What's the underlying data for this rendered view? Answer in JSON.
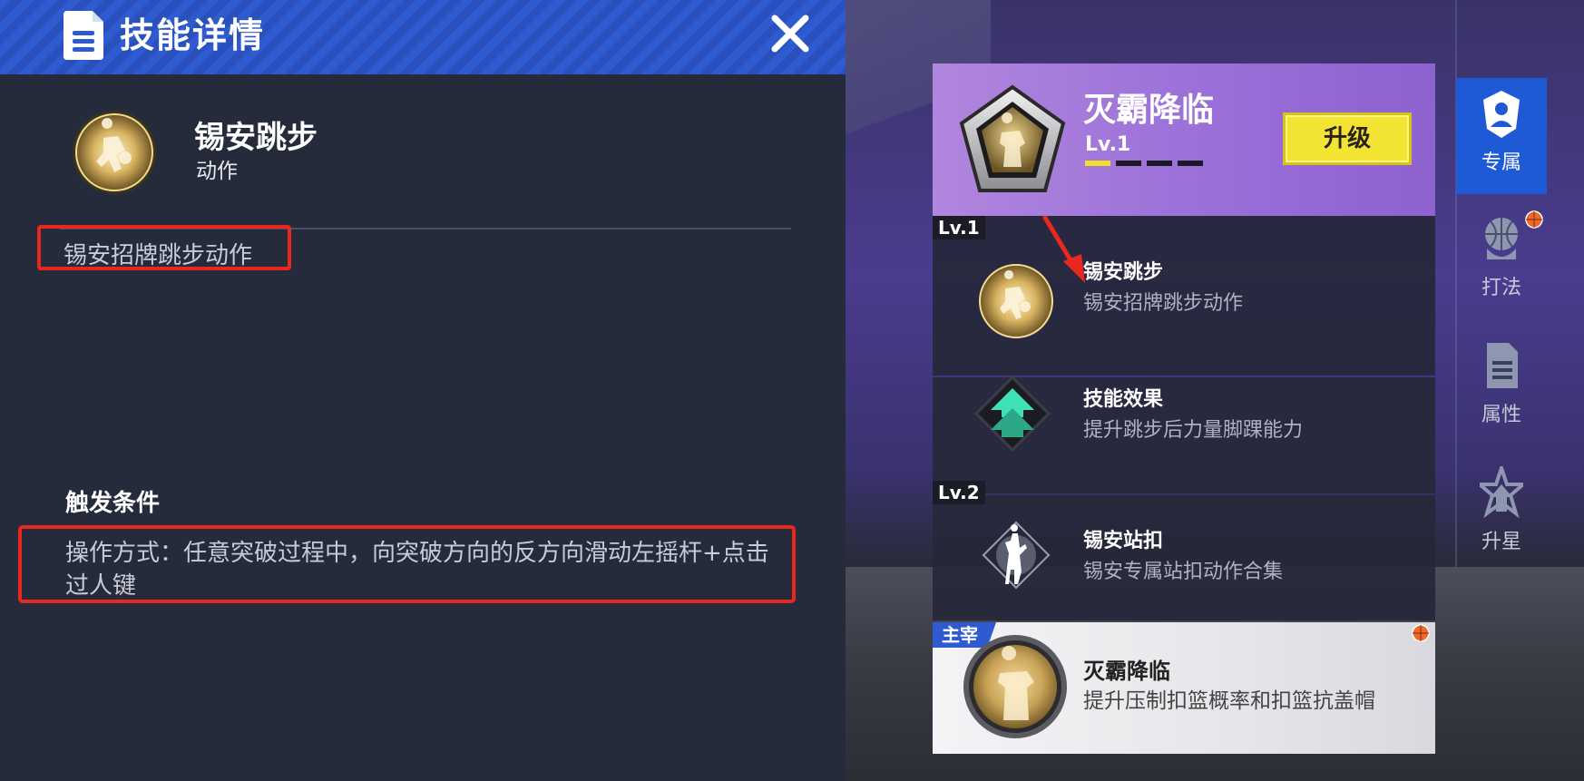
{
  "left_panel": {
    "header_title": "技能详情",
    "skill_name": "锡安跳步",
    "skill_type": "动作",
    "skill_description": "锡安招牌跳步动作",
    "trigger_title": "触发条件",
    "trigger_text": "操作方式：任意突破过程中，向突破方向的反方向滑动左摇杆+点击过人键"
  },
  "top_card": {
    "name": "灭霸降临",
    "level": "Lv.1",
    "level_progress": 0.25,
    "upgrade_label": "升级"
  },
  "skill_list": {
    "groups": [
      {
        "level": "Lv.1",
        "items": [
          {
            "title": "锡安跳步",
            "desc": "锡安招牌跳步动作"
          },
          {
            "title": "技能效果",
            "desc": "提升跳步后力量脚踝能力"
          }
        ]
      },
      {
        "level": "Lv.2",
        "items": [
          {
            "title": "锡安站扣",
            "desc": "锡安专属站扣动作合集"
          }
        ]
      }
    ],
    "dominant": {
      "badge": "主宰",
      "title": "灭霸降临",
      "desc": "提升压制扣篮概率和扣篮抗盖帽"
    }
  },
  "side_nav": {
    "items": [
      {
        "label": "专属",
        "icon": "exclusive-player-icon",
        "active": true
      },
      {
        "label": "打法",
        "icon": "playstyle-basketball-icon",
        "active": false,
        "badge": true
      },
      {
        "label": "属性",
        "icon": "attributes-document-icon",
        "active": false
      },
      {
        "label": "升星",
        "icon": "star-upgrade-icon",
        "active": false
      }
    ]
  },
  "colors": {
    "header_blue": "#2f5bd0",
    "highlight_red": "#e8281f",
    "upgrade_yellow": "#f3e433",
    "card_purple": "#9a6fd8",
    "nav_active": "#1f5ad6"
  }
}
